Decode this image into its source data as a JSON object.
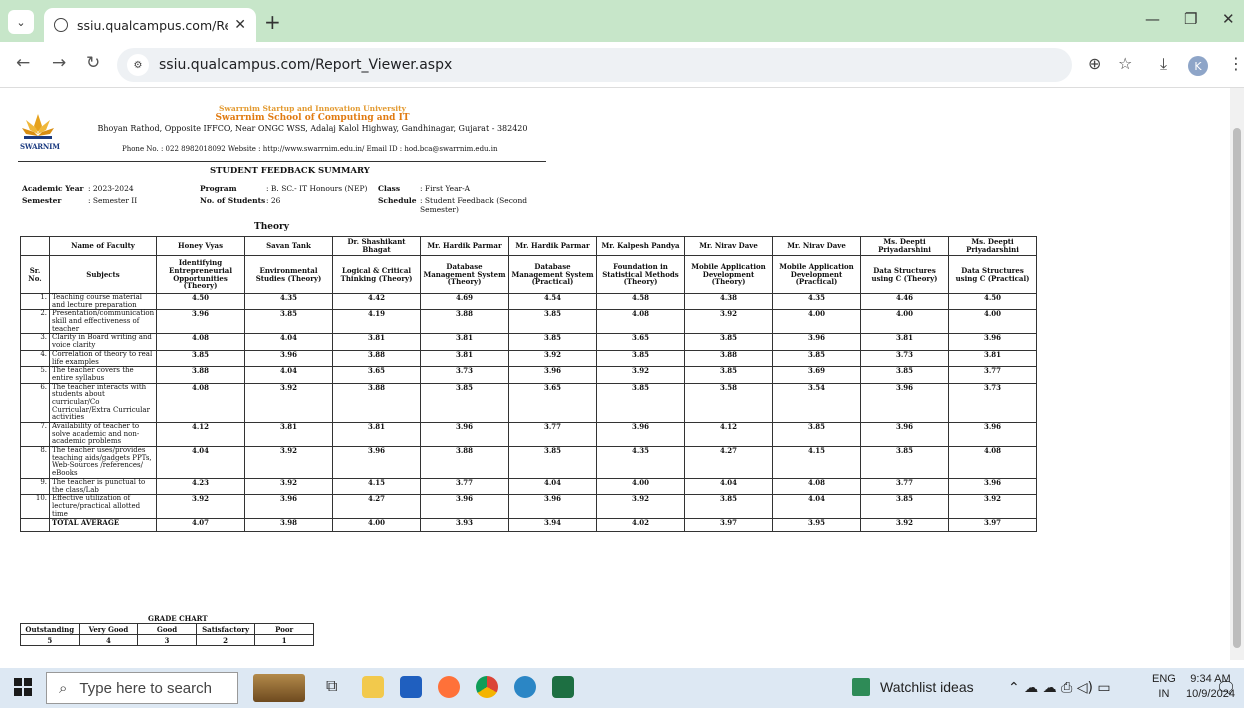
{
  "browser": {
    "tab_title": "ssiu.qualcampus.com/Report_Vi",
    "address": "ssiu.qualcampus.com/Report_Viewer.aspx",
    "profile_initial": "K"
  },
  "header": {
    "logo_text": "SWARNIM",
    "university": "Swarrnim Startup and Innovation University",
    "school": "Swarrnim School of Computing and IT",
    "address": "Bhoyan Rathod, Opposite IFFCO, Near ONGC WSS, Adalaj Kalol Highway, Gandhinagar, Gujarat - 382420",
    "contact": "Phone No. : 022 8982018092 Website : http://www.swarrnim.edu.in/ Email ID : hod.bca@swarrnim.edu.in"
  },
  "report": {
    "title": "STUDENT FEEDBACK SUMMARY",
    "academic_year_label": "Academic Year",
    "academic_year": ": 2023-2024",
    "semester_label": "Semester",
    "semester": ": Semester II",
    "program_label": "Program",
    "program": ": B. SC.- IT Honours (NEP)",
    "students_label": "No. of Students",
    "students": ": 26",
    "class_label": "Class",
    "class": ": First Year-A",
    "schedule_label": "Schedule",
    "schedule": ": Student Feedback (Second Semester)",
    "section_title": "Theory"
  },
  "table": {
    "faculty_header": "Name of Faculty",
    "srno_header": "Sr. No.",
    "subjects_header": "Subjects",
    "faculty": [
      "Honey Vyas",
      "Savan Tank",
      "Dr. Shashikant Bhagat",
      "Mr. Hardik Parmar",
      "Mr. Hardik Parmar",
      "Mr. Kalpesh Pandya",
      "Mr. Nirav Dave",
      "Mr. Nirav Dave",
      "Ms. Deepti Priyadarshini",
      "Ms. Deepti Priyadarshini"
    ],
    "subjects": [
      "Identifying Entrepreneurial Opportunities (Theory)",
      "Environmental Studies (Theory)",
      "Logical & Critical Thinking (Theory)",
      "Database Management System (Theory)",
      "Database Management System (Practical)",
      "Foundation in Statistical Methods (Theory)",
      "Mobile Application Development (Theory)",
      "Mobile Application Development (Practical)",
      "Data Structures using C (Theory)",
      "Data Structures using C (Practical)"
    ],
    "rows": [
      {
        "no": "1.",
        "q": "Teaching course material and lecture preparation",
        "v": [
          "4.50",
          "4.35",
          "4.42",
          "4.69",
          "4.54",
          "4.58",
          "4.38",
          "4.35",
          "4.46",
          "4.50"
        ]
      },
      {
        "no": "2.",
        "q": "Presentation/communication skill and effectiveness of teacher",
        "v": [
          "3.96",
          "3.85",
          "4.19",
          "3.88",
          "3.85",
          "4.08",
          "3.92",
          "4.00",
          "4.00",
          "4.00"
        ]
      },
      {
        "no": "3.",
        "q": "Clarity in Board writing and voice clarity",
        "v": [
          "4.08",
          "4.04",
          "3.81",
          "3.81",
          "3.85",
          "3.65",
          "3.85",
          "3.96",
          "3.81",
          "3.96"
        ]
      },
      {
        "no": "4.",
        "q": "Correlation of theory to real life examples",
        "v": [
          "3.85",
          "3.96",
          "3.88",
          "3.81",
          "3.92",
          "3.85",
          "3.88",
          "3.85",
          "3.73",
          "3.81"
        ]
      },
      {
        "no": "5.",
        "q": "The teacher covers the entire syllabus",
        "v": [
          "3.88",
          "4.04",
          "3.65",
          "3.73",
          "3.96",
          "3.92",
          "3.85",
          "3.69",
          "3.85",
          "3.77"
        ]
      },
      {
        "no": "6.",
        "q": "The teacher interacts with students about curricular/Co Curricular/Extra Curricular activities",
        "v": [
          "4.08",
          "3.92",
          "3.88",
          "3.85",
          "3.65",
          "3.85",
          "3.58",
          "3.54",
          "3.96",
          "3.73"
        ]
      },
      {
        "no": "7.",
        "q": "Availability of teacher to solve academic and non-academic problems",
        "v": [
          "4.12",
          "3.81",
          "3.81",
          "3.96",
          "3.77",
          "3.96",
          "4.12",
          "3.85",
          "3.96",
          "3.96"
        ]
      },
      {
        "no": "8.",
        "q": "The teacher uses/provides teaching aids/gadgets PPTs, Web-Sources /references/ eBooks",
        "v": [
          "4.04",
          "3.92",
          "3.96",
          "3.88",
          "3.85",
          "4.35",
          "4.27",
          "4.15",
          "3.85",
          "4.08"
        ]
      },
      {
        "no": "9.",
        "q": "The teacher is punctual to the class/Lab",
        "v": [
          "4.23",
          "3.92",
          "4.15",
          "3.77",
          "4.04",
          "4.00",
          "4.04",
          "4.08",
          "3.77",
          "3.96"
        ]
      },
      {
        "no": "10.",
        "q": "Effective utilization of lecture/practical allotted time",
        "v": [
          "3.92",
          "3.96",
          "4.27",
          "3.96",
          "3.96",
          "3.92",
          "3.85",
          "4.04",
          "3.85",
          "3.92"
        ]
      }
    ],
    "total_label": "TOTAL AVERAGE",
    "totals": [
      "4.07",
      "3.98",
      "4.00",
      "3.93",
      "3.94",
      "4.02",
      "3.97",
      "3.95",
      "3.92",
      "3.97"
    ]
  },
  "grade_chart": {
    "title": "GRADE CHART",
    "labels": [
      "Outstanding",
      "Very Good",
      "Good",
      "Satisfactory",
      "Poor"
    ],
    "values": [
      "5",
      "4",
      "3",
      "2",
      "1"
    ]
  },
  "taskbar": {
    "search_placeholder": "Type here to search",
    "watchlist": "Watchlist ideas",
    "lang_line1": "ENG",
    "lang_line2": "IN",
    "time": "9:34 AM",
    "date": "10/9/2024",
    "notif_count": "1"
  }
}
